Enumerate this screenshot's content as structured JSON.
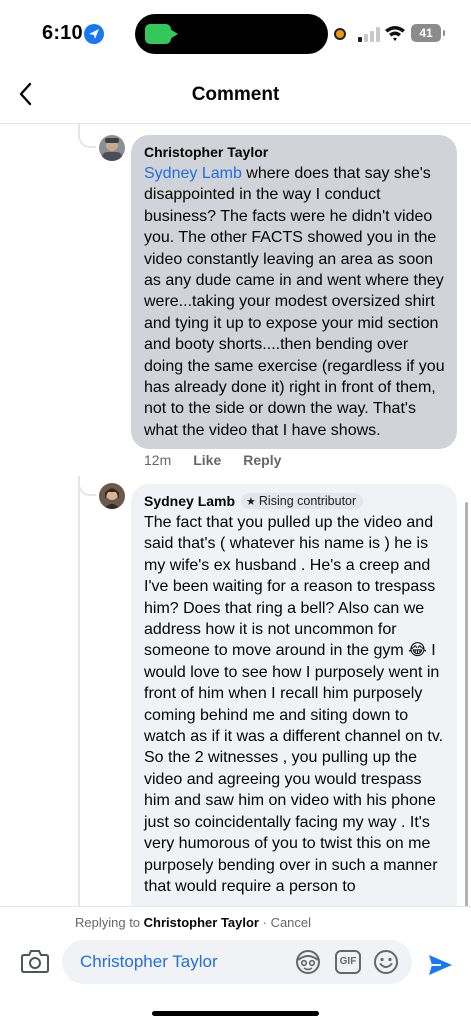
{
  "status_bar": {
    "time": "6:10",
    "battery": "41"
  },
  "header": {
    "title": "Comment"
  },
  "comments": [
    {
      "author": "Christopher Taylor",
      "mention": "Sydney Lamb",
      "text": " where does that say she's disappointed in the way I conduct business? The facts were he didn't video you. The other FACTS showed you in the video constantly leaving an area as soon as any dude came in and went where they were...taking your modest oversized shirt and tying it up to expose your mid section and booty shorts....then bending over doing the same exercise (regardless if you has already done it) right in front of them, not to the side or down the way. That's what the video that I have shows.",
      "time": "12m",
      "like_label": "Like",
      "reply_label": "Reply"
    },
    {
      "author": "Sydney Lamb",
      "badge": "Rising contributor",
      "text": "The fact that you pulled up the video and said that's ( whatever his name is ) he is my wife's ex husband . He's a creep and I've been waiting for a reason to trespass him? Does that ring a bell? Also can we address how it is not uncommon for someone to move around in the gym 😂 I would love to see how I purposely went in front of him when I recall him purposely coming behind me and siting down to watch as if it was a different channel on tv. So the 2 witnesses , you pulling up the video and agreeing you would trespass him and saw him on video with his phone just so coincidentally facing my way . It's very humorous of you to twist this on me purposely bending over in such a manner that would require a person to"
    }
  ],
  "reply_bar": {
    "replying_prefix": "Replying to ",
    "replying_to": "Christopher Taylor",
    "separator": " · ",
    "cancel_label": "Cancel",
    "input_value": "Christopher Taylor"
  },
  "colors": {
    "link": "#216fdb",
    "selected_bubble": "#d0d3d7",
    "bubble": "#f0f2f5",
    "send": "#1877f2"
  }
}
